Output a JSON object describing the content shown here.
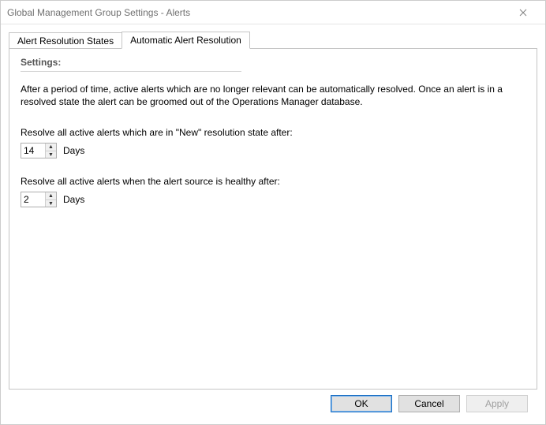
{
  "window": {
    "title": "Global Management Group Settings - Alerts"
  },
  "tabs": {
    "alert_resolution_states": "Alert Resolution States",
    "automatic_alert_resolution": "Automatic Alert Resolution"
  },
  "panel": {
    "settings_header": "Settings:",
    "description": "After a period of time, active alerts which are no longer relevant can be automatically resolved. Once an alert is in a resolved state the alert can be groomed out of the Operations Manager database.",
    "field1": {
      "label": "Resolve all active alerts which are in \"New\" resolution state after:",
      "value": "14",
      "unit": "Days"
    },
    "field2": {
      "label": "Resolve all active alerts when the alert source is healthy after:",
      "value": "2",
      "unit": "Days"
    }
  },
  "buttons": {
    "ok": "OK",
    "cancel": "Cancel",
    "apply": "Apply"
  }
}
